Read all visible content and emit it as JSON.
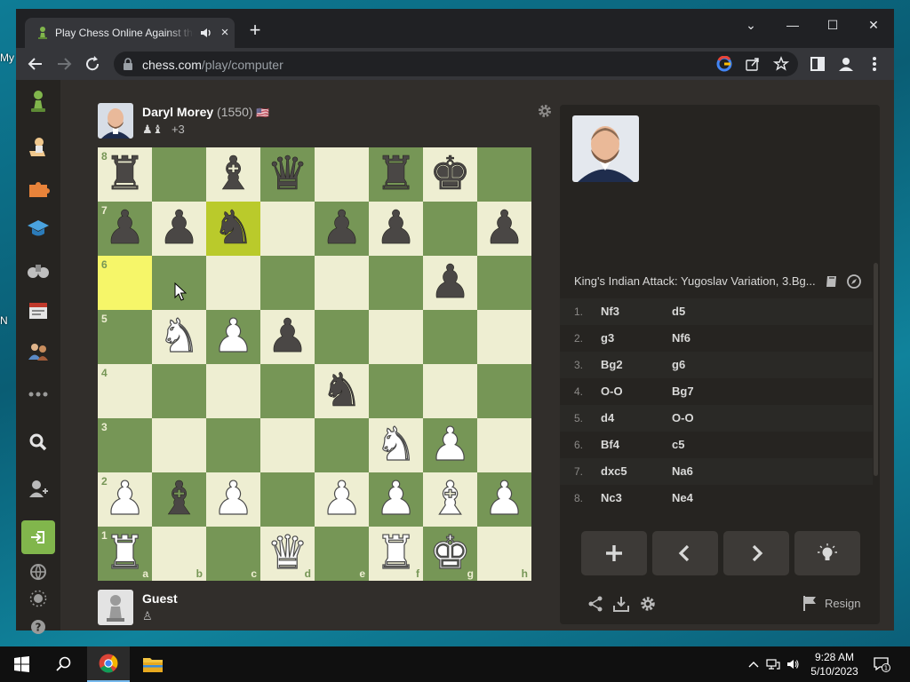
{
  "desktop": {
    "stub_texts": [
      "My",
      "N"
    ]
  },
  "browser": {
    "tab": {
      "title": "Play Chess Online Against the Computer",
      "close": "×"
    },
    "new_tab": "+",
    "window": {
      "minimize": "—",
      "maximize": "☐",
      "close": "✕",
      "dropdown": "⌄"
    },
    "url": {
      "host": "chess.com",
      "path": "/play/computer"
    }
  },
  "game": {
    "top_player": {
      "name": "Daryl Morey",
      "rating": "(1550)",
      "flag": "🇺🇸",
      "captured": "♟♝",
      "advantage": "+3"
    },
    "bottom_player": {
      "name": "Guest",
      "captured": "♙"
    },
    "board": {
      "ranks": [
        "8",
        "7",
        "6",
        "5",
        "4",
        "3",
        "2",
        "1"
      ],
      "files": [
        "a",
        "b",
        "c",
        "d",
        "e",
        "f",
        "g",
        "h"
      ],
      "position": [
        [
          "bR",
          "",
          "bB",
          "bQ",
          "",
          "bR",
          "bK",
          ""
        ],
        [
          "bP",
          "bP",
          "bN",
          "",
          "bP",
          "bP",
          "",
          "bP"
        ],
        [
          "",
          "",
          "",
          "",
          "",
          "",
          "bP",
          ""
        ],
        [
          "",
          "wN",
          "wP",
          "bP",
          "",
          "",
          "",
          ""
        ],
        [
          "",
          "",
          "",
          "",
          "bN",
          "",
          "",
          ""
        ],
        [
          "",
          "",
          "",
          "",
          "",
          "wN",
          "wP",
          ""
        ],
        [
          "wP",
          "bB",
          "wP",
          "",
          "wP",
          "wP",
          "wB",
          "wP"
        ],
        [
          "wR",
          "",
          "",
          "wQ",
          "",
          "wR",
          "wK",
          ""
        ]
      ],
      "highlight": [
        "a6",
        "c7"
      ]
    },
    "opening": "King's Indian Attack: Yugoslav Variation, 3.Bg...",
    "moves": [
      {
        "num": "1.",
        "white": "Nf3",
        "black": "d5"
      },
      {
        "num": "2.",
        "white": "g3",
        "black": "Nf6"
      },
      {
        "num": "3.",
        "white": "Bg2",
        "black": "g6"
      },
      {
        "num": "4.",
        "white": "O-O",
        "black": "Bg7"
      },
      {
        "num": "5.",
        "white": "d4",
        "black": "O-O"
      },
      {
        "num": "6.",
        "white": "Bf4",
        "black": "c5"
      },
      {
        "num": "7.",
        "white": "dxc5",
        "black": "Na6"
      },
      {
        "num": "8.",
        "white": "Nc3",
        "black": "Ne4"
      }
    ],
    "resign": "Resign"
  },
  "taskbar": {
    "time": "9:28 AM",
    "date": "5/10/2023",
    "notif_count": "1"
  },
  "colors": {
    "light_square": "#eeeed2",
    "dark_square": "#769656",
    "accent": "#81b64c",
    "highlight": "#f6f669"
  }
}
